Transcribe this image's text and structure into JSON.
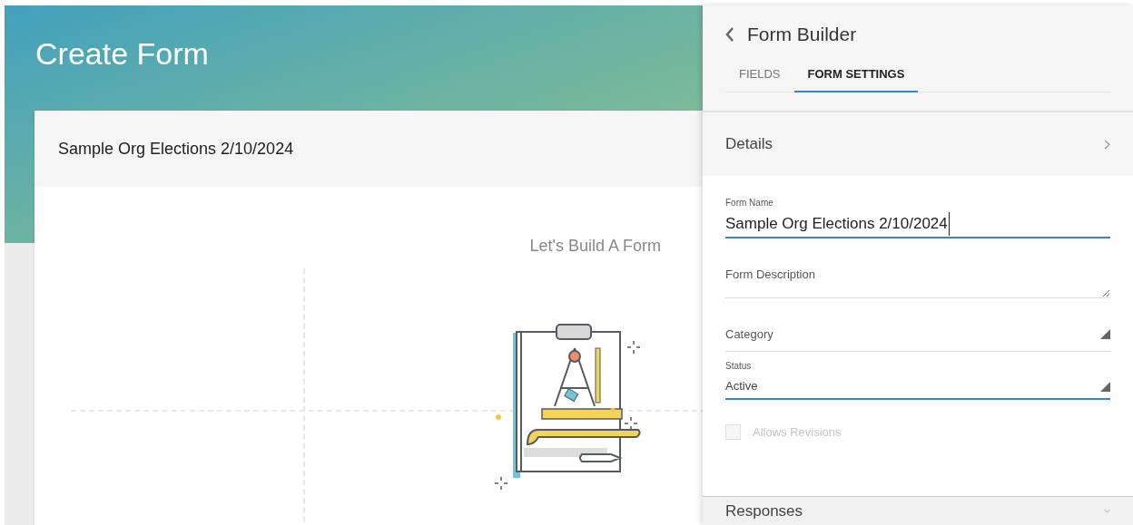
{
  "page": {
    "title": "Create Form"
  },
  "form_card": {
    "title": "Sample Org Elections 2/10/2024",
    "empty_state": "Let's Build A Form"
  },
  "panel": {
    "title": "Form Builder",
    "tabs": [
      {
        "label": "FIELDS",
        "selected": false
      },
      {
        "label": "FORM SETTINGS",
        "selected": true
      }
    ],
    "sections": [
      {
        "title": "Details",
        "expanded": true
      },
      {
        "title": "Responses",
        "expanded": false
      }
    ],
    "fields": [
      {
        "kind": "text",
        "label": "Form Name",
        "value": "Sample Org Elections 2/10/2024",
        "focused": true
      },
      {
        "kind": "textarea",
        "placeholder": "Form Description",
        "focused": false
      },
      {
        "kind": "select",
        "placeholder": "Category",
        "focused": false
      },
      {
        "kind": "select",
        "label": "Status",
        "value": "Active",
        "focused": true
      },
      {
        "kind": "checkbox",
        "label": "Allows Revisions",
        "checked": false,
        "disabled": true
      }
    ]
  }
}
